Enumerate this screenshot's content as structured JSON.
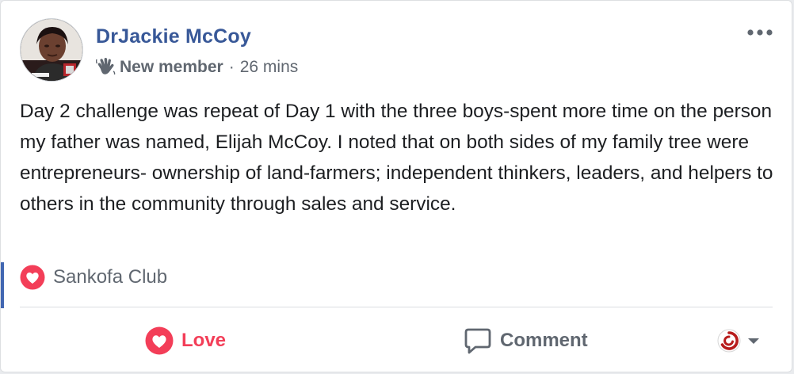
{
  "post": {
    "author": {
      "name": "DrJackie McCoy",
      "avatar_icon": "profile-photo",
      "badge_icon": "waving-hand-icon",
      "badge": "New member"
    },
    "meta_separator": "·",
    "timestamp": "26 mins",
    "more_icon": "more-options-icon",
    "body": "Day 2 challenge was repeat of Day 1 with the three boys-spent more time on the person my father was named, Elijah McCoy. I noted that on both sides of my family tree were entrepreneurs- ownership of land-farmers; independent thinkers, leaders, and helpers to others in the community through sales and service."
  },
  "group": {
    "icon": "heart-reaction-icon",
    "name": "Sankofa Club"
  },
  "actions": {
    "love": {
      "icon": "love-heart-icon",
      "label": "Love"
    },
    "comment": {
      "icon": "comment-bubble-icon",
      "label": "Comment"
    },
    "reaction_picker": {
      "icon": "page-avatar-icon",
      "caret_icon": "caret-down-icon"
    }
  },
  "colors": {
    "name_link": "#385898",
    "love_red": "#f33e58",
    "secondary_text": "#606770",
    "body_text": "#1c1e21",
    "accent_bar": "#4267b2"
  }
}
